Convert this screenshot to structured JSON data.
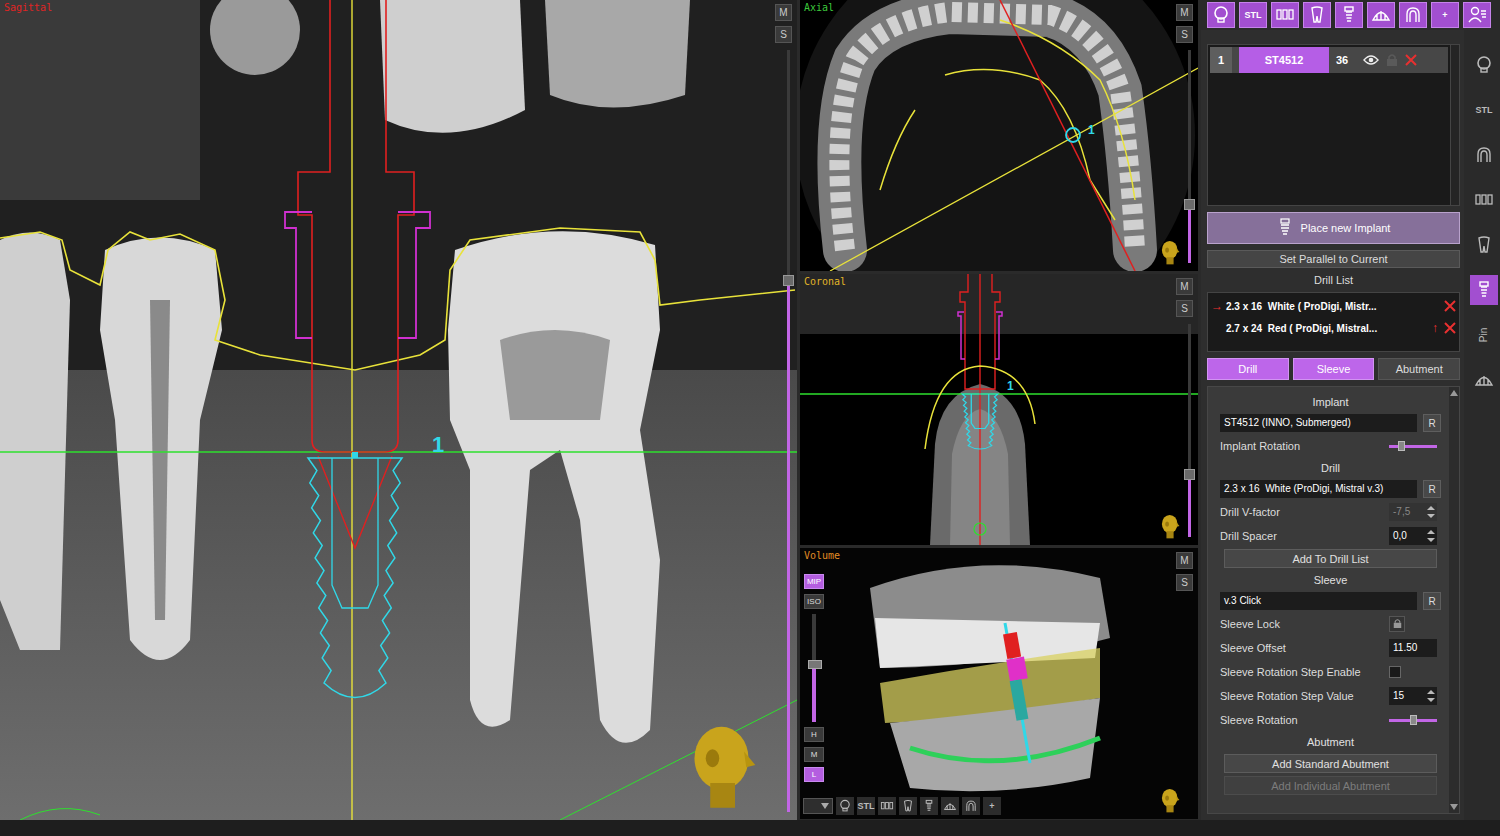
{
  "views": {
    "sagittal": {
      "title": "Sagittal",
      "color": "#e02424",
      "buttons": [
        "M",
        "S"
      ],
      "implant_label": "1",
      "slice_level": 0.3
    },
    "axial": {
      "title": "Axial",
      "color": "#3cc83c",
      "buttons": [
        "M",
        "S"
      ],
      "implant_label": "1",
      "slice_level": 0.72
    },
    "coronal": {
      "title": "Coronal",
      "color": "#e0b428",
      "buttons": [
        "M",
        "S"
      ],
      "implant_label": "1",
      "slice_level": 0.7
    },
    "volume": {
      "title": "Volume",
      "color": "#e08c24",
      "buttons": [
        "M",
        "S"
      ],
      "modes": [
        {
          "label": "MIP",
          "selected": true
        },
        {
          "label": "ISO",
          "selected": false
        }
      ],
      "opacity_level": 0.45,
      "levels": [
        {
          "label": "H",
          "selected": false
        },
        {
          "label": "M",
          "selected": false
        },
        {
          "label": "L",
          "selected": true
        }
      ],
      "bottom_tools": [
        {
          "kind": "skull",
          "label": ""
        },
        {
          "kind": "stl",
          "label": "STL"
        },
        {
          "kind": "teeth",
          "label": ""
        },
        {
          "kind": "tooth",
          "label": ""
        },
        {
          "kind": "implant",
          "label": ""
        },
        {
          "kind": "dome",
          "label": ""
        },
        {
          "kind": "arch",
          "label": ""
        },
        {
          "kind": "plus",
          "label": "+"
        }
      ]
    }
  },
  "top_toolbar": [
    {
      "kind": "skull",
      "label": ""
    },
    {
      "kind": "stl",
      "label": "STL"
    },
    {
      "kind": "teeth",
      "label": ""
    },
    {
      "kind": "tooth",
      "label": ""
    },
    {
      "kind": "implant",
      "label": ""
    },
    {
      "kind": "dome",
      "label": ""
    },
    {
      "kind": "arch",
      "label": ""
    },
    {
      "kind": "plus",
      "label": "+"
    },
    {
      "kind": "person",
      "label": ""
    }
  ],
  "side_toolbar": [
    {
      "kind": "skull",
      "label": "",
      "selected": false
    },
    {
      "kind": "stl",
      "label": "STL",
      "selected": false
    },
    {
      "kind": "arch",
      "label": "",
      "selected": false
    },
    {
      "kind": "teeth",
      "label": "",
      "selected": false
    },
    {
      "kind": "tooth",
      "label": "",
      "selected": false
    },
    {
      "kind": "implant",
      "label": "",
      "selected": true
    },
    {
      "kind": "pin",
      "label": "Pin",
      "selected": false
    },
    {
      "kind": "dome",
      "label": "",
      "selected": false
    }
  ],
  "implants": [
    {
      "number": "1",
      "name": "ST4512",
      "tooth": "36",
      "visible": true,
      "locked": false,
      "selected": true
    }
  ],
  "actions": {
    "place": "Place new Implant",
    "parallel": "Set Parallel to Current"
  },
  "drill_list": {
    "title": "Drill List",
    "items": [
      {
        "marker": "→",
        "label": "2.3 x 16  White ( ProDigi, Mistr...",
        "move": "",
        "selected": true
      },
      {
        "marker": "",
        "label": "2.7 x 24  Red ( ProDigi, Mistral...",
        "move": "↑",
        "selected": false
      }
    ]
  },
  "tabs": [
    {
      "label": "Drill",
      "selected": true
    },
    {
      "label": "Sleeve",
      "selected": true
    },
    {
      "label": "Abutment",
      "selected": false
    }
  ],
  "properties": [
    {
      "kind": "heading",
      "label": "Implant"
    },
    {
      "kind": "field",
      "value": "ST4512 (INNO, Submerged)",
      "button": "R"
    },
    {
      "kind": "slider",
      "label": "Implant Rotation",
      "level": 0.25
    },
    {
      "kind": "heading",
      "label": "Drill"
    },
    {
      "kind": "field",
      "value": "2.3 x 16  White (ProDigi, Mistral v.3)",
      "button": "R"
    },
    {
      "kind": "spin",
      "label": "Drill V-factor",
      "value": "-7,5",
      "disabled": true
    },
    {
      "kind": "spin",
      "label": "Drill Spacer",
      "value": "0,0",
      "disabled": false
    },
    {
      "kind": "button",
      "label": "Add To Drill List",
      "disabled": false
    },
    {
      "kind": "heading",
      "label": "Sleeve"
    },
    {
      "kind": "field",
      "value": "v.3 Click",
      "button": "R"
    },
    {
      "kind": "lock",
      "label": "Sleeve Lock",
      "locked": false
    },
    {
      "kind": "input",
      "label": "Sleeve Offset",
      "value": "11.50"
    },
    {
      "kind": "checkbox",
      "label": "Sleeve Rotation Step Enable",
      "checked": false
    },
    {
      "kind": "spin",
      "label": "Sleeve Rotation Step Value",
      "value": "15",
      "disabled": false
    },
    {
      "kind": "slider",
      "label": "Sleeve Rotation",
      "level": 0.5
    },
    {
      "kind": "heading",
      "label": "Abutment"
    },
    {
      "kind": "button",
      "label": "Add Standard Abutment",
      "disabled": false
    },
    {
      "kind": "button",
      "label": "Add Individual Abutment",
      "disabled": true
    }
  ]
}
